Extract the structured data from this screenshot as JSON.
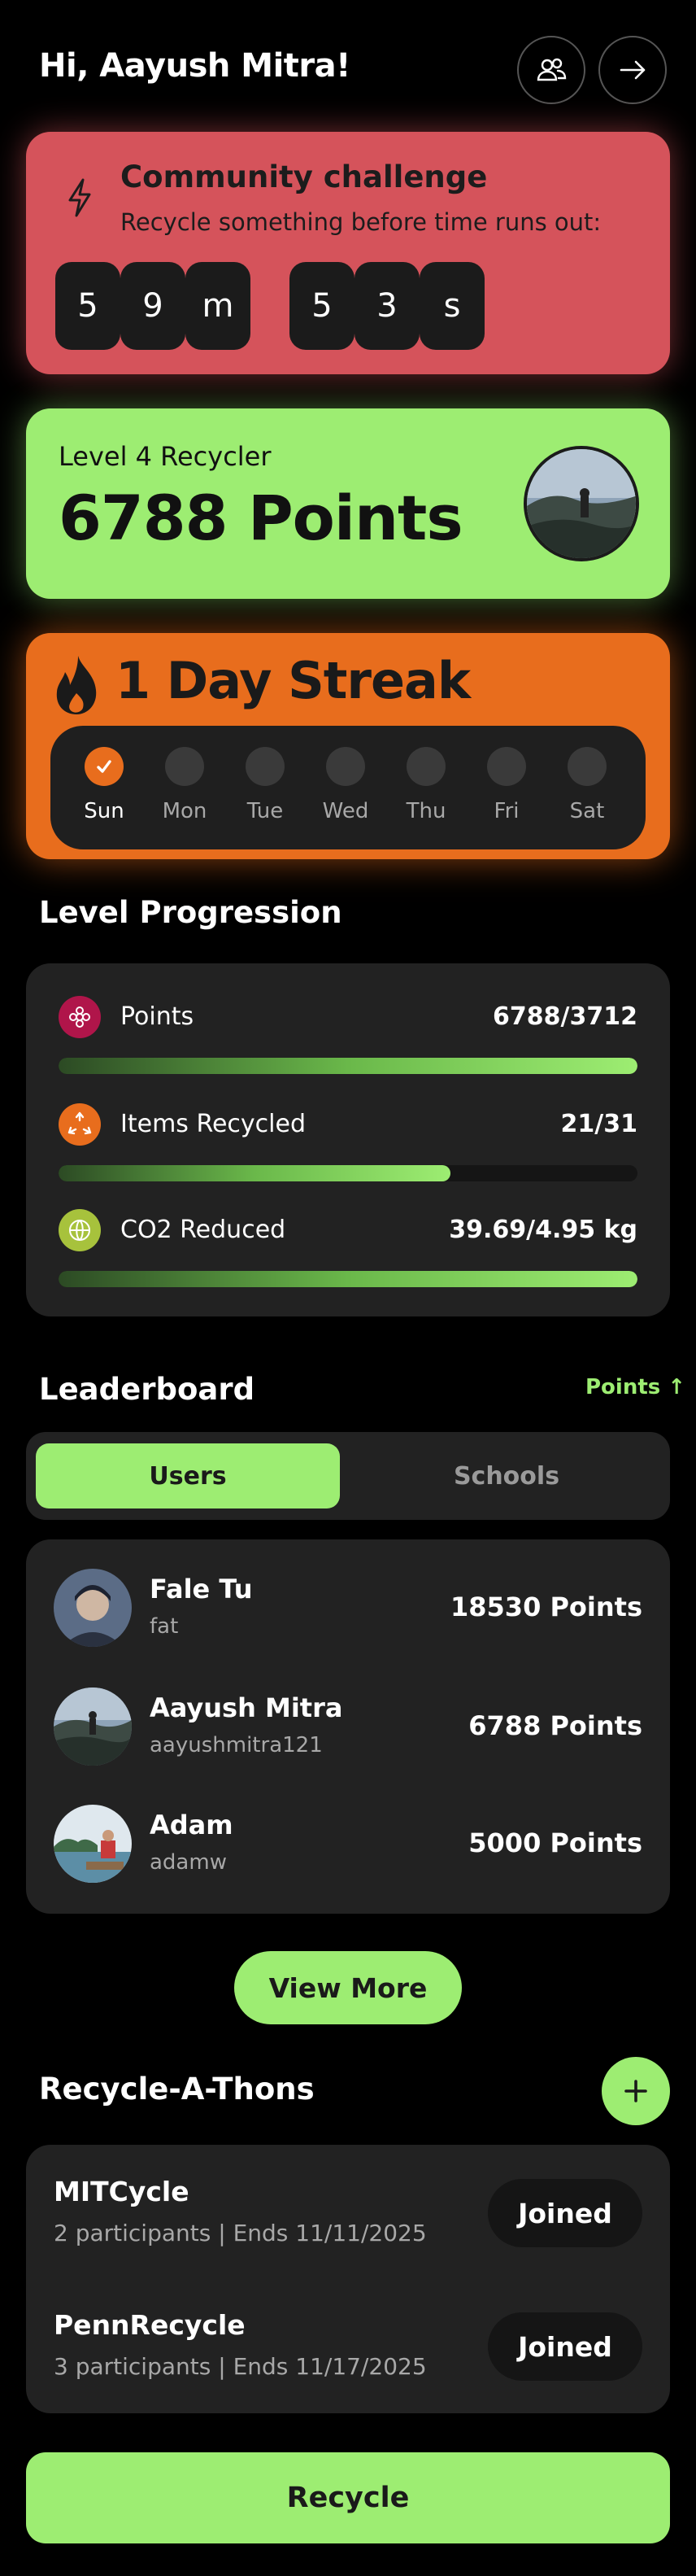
{
  "header": {
    "greeting": "Hi, Aayush Mitra!",
    "friends_icon": "people-icon",
    "logout_icon": "arrow-right-icon"
  },
  "challenge": {
    "icon": "lightning-icon",
    "title": "Community challenge",
    "subtitle": "Recycle something before time runs out:",
    "timer": [
      "5",
      "9",
      "m",
      "5",
      "3",
      "s"
    ]
  },
  "level": {
    "label": "Level 4 Recycler",
    "points": "6788 Points"
  },
  "streak": {
    "title": "1 Day Streak",
    "days": [
      {
        "label": "Sun",
        "done": true
      },
      {
        "label": "Mon",
        "done": false
      },
      {
        "label": "Tue",
        "done": false
      },
      {
        "label": "Wed",
        "done": false
      },
      {
        "label": "Thu",
        "done": false
      },
      {
        "label": "Fri",
        "done": false
      },
      {
        "label": "Sat",
        "done": false
      }
    ]
  },
  "progression": {
    "title": "Level Progression",
    "rows": [
      {
        "name": "Points",
        "value": "6788/3712",
        "fraction": 1.0,
        "icon": "flower-icon",
        "icon_color": "#b0154a"
      },
      {
        "name": "Items Recycled",
        "value": "21/31",
        "fraction": 0.677,
        "icon": "recycle-icon",
        "icon_color": "#e86d1d"
      },
      {
        "name": "CO2 Reduced",
        "value": "39.69/4.95 kg",
        "fraction": 1.0,
        "icon": "globe-icon",
        "icon_color": "#a7c23c"
      }
    ]
  },
  "leaderboard": {
    "title": "Leaderboard",
    "sort_label": "Points ↑",
    "tabs": [
      "Users",
      "Schools"
    ],
    "active_tab": "Users",
    "rows": [
      {
        "name": "Fale Tu",
        "handle": "fat",
        "points": "18530 Points"
      },
      {
        "name": "Aayush Mitra",
        "handle": "aayushmitra121",
        "points": "6788 Points"
      },
      {
        "name": "Adam",
        "handle": "adamw",
        "points": "5000 Points"
      }
    ],
    "view_more": "View More"
  },
  "recycle_a_thons": {
    "title": "Recycle-A-Thons",
    "add_icon": "plus-icon",
    "items": [
      {
        "name": "MITCycle",
        "meta": "2 participants | Ends 11/11/2025",
        "status": "Joined"
      },
      {
        "name": "PennRecycle",
        "meta": "3 participants | Ends 11/17/2025",
        "status": "Joined"
      }
    ]
  },
  "recycle_button": "Recycle",
  "colors": {
    "accent_green": "#9ded72",
    "challenge_red": "#d5535b",
    "streak_orange": "#e86d1d",
    "card_dark": "#222222"
  }
}
